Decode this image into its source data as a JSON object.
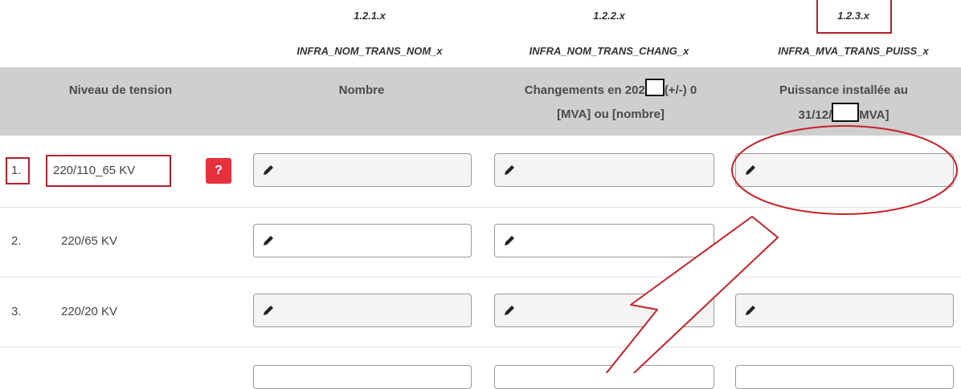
{
  "columns": [
    {
      "code": "1.2.1.x",
      "variable": "INFRA_NOM_TRANS_NOM_x",
      "header_line1": "Nombre",
      "header_line2": ""
    },
    {
      "code": "1.2.2.x",
      "variable": "INFRA_NOM_TRANS_CHANG_x",
      "header_line1_a": "Changements en 202",
      "header_line1_b": "(+/-) 0",
      "header_line2": "[MVA] ou [nombre]"
    },
    {
      "code": "1.2.3.x",
      "variable": "INFRA_MVA_TRANS_PUISS_x",
      "header_line1": "Puissance installée au",
      "header_line2_a": "31/12/",
      "header_line2_b": "MVA]"
    }
  ],
  "level_header": "Niveau de tension",
  "help_label": "?",
  "rows": [
    {
      "num": "1.",
      "level": "220/110_65 KV"
    },
    {
      "num": "2.",
      "level": "220/65 KV"
    },
    {
      "num": "3.",
      "level": "220/20 KV"
    }
  ],
  "annotation_color": "#b3202c",
  "help_color": "#e8313e"
}
